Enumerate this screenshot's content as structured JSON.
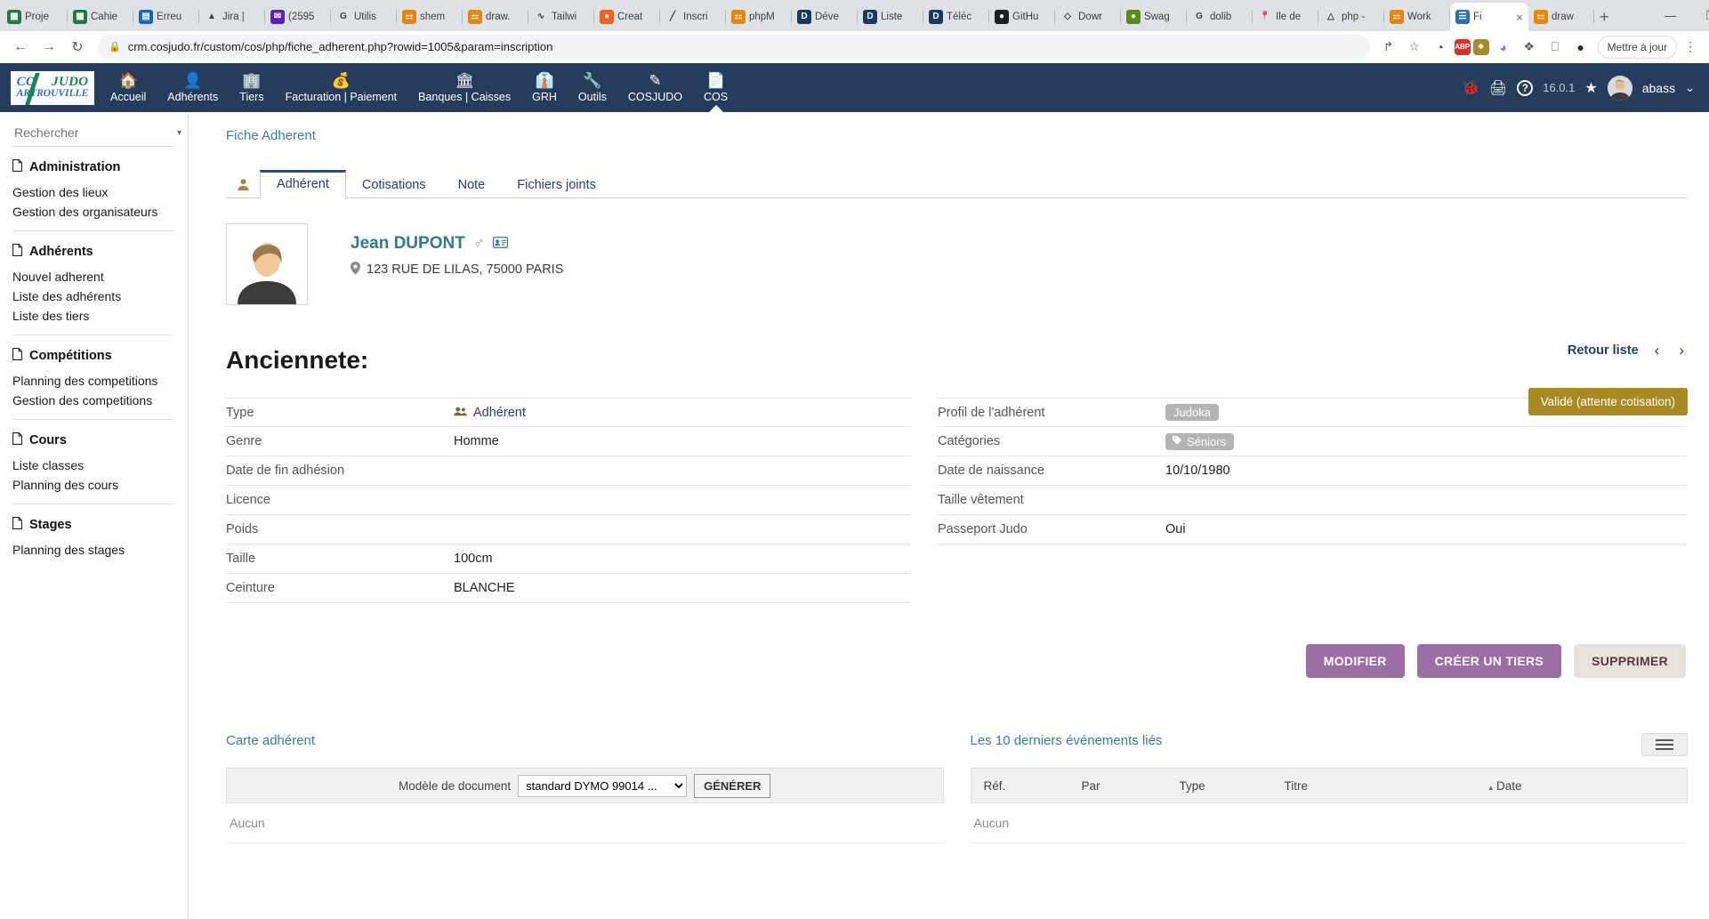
{
  "browser": {
    "tabs": [
      {
        "title": "Proje",
        "favicon": "spreadsheet-green",
        "color": "#1e7a43",
        "glyph": "▦"
      },
      {
        "title": "Cahie",
        "favicon": "spreadsheet-green",
        "color": "#1e7a43",
        "glyph": "▦"
      },
      {
        "title": "Erreu",
        "favicon": "trello-blue",
        "color": "#1565c0",
        "glyph": "▤"
      },
      {
        "title": "Jira |",
        "favicon": "jira-blue",
        "color": "#ffffff",
        "glyph": "▲"
      },
      {
        "title": "(2595",
        "favicon": "mail-purple",
        "color": "#5b21b6",
        "glyph": "✉"
      },
      {
        "title": "Utilis",
        "favicon": "google-g",
        "color": "#ffffff",
        "glyph": "G"
      },
      {
        "title": "shem",
        "favicon": "drawio-orange",
        "color": "#e8830c",
        "glyph": "⚏"
      },
      {
        "title": "draw.",
        "favicon": "drawio-orange",
        "color": "#e8830c",
        "glyph": "⚏"
      },
      {
        "title": "Tailwi",
        "favicon": "tailwind-cyan",
        "color": "#ffffff",
        "glyph": "∿"
      },
      {
        "title": "Creat",
        "favicon": "flame-orange",
        "color": "#f26122",
        "glyph": "●"
      },
      {
        "title": "Inscri",
        "favicon": "pencil-blue",
        "color": "#ffffff",
        "glyph": "╱"
      },
      {
        "title": "phpM",
        "favicon": "phpmyadmin-orange",
        "color": "#e8830c",
        "glyph": "⚏"
      },
      {
        "title": "Déve",
        "favicon": "dolibarr-d",
        "color": "#1b3a63",
        "glyph": "D"
      },
      {
        "title": "Liste",
        "favicon": "dolibarr-d",
        "color": "#1b3a63",
        "glyph": "D"
      },
      {
        "title": "Téléc",
        "favicon": "dolibarr-d",
        "color": "#1b3a63",
        "glyph": "D"
      },
      {
        "title": "GitHu",
        "favicon": "github-dark",
        "color": "#1b1f23",
        "glyph": "●"
      },
      {
        "title": "Dowr",
        "favicon": "diamond-orange",
        "color": "#ffffff",
        "glyph": "◇"
      },
      {
        "title": "Swag",
        "favicon": "swagger-green",
        "color": "#5a8a1a",
        "glyph": "●"
      },
      {
        "title": "dolib",
        "favicon": "google-g",
        "color": "#ffffff",
        "glyph": "G"
      },
      {
        "title": "Ile de",
        "favicon": "maps-pin",
        "color": "#ffffff",
        "glyph": "📍"
      },
      {
        "title": "php -",
        "favicon": "drive-triangle",
        "color": "#ffffff",
        "glyph": "△"
      },
      {
        "title": "Work",
        "favicon": "drawio-orange",
        "color": "#e8830c",
        "glyph": "⚏"
      },
      {
        "title": "Fi",
        "favicon": "judo-site",
        "color": "#2e6fb7",
        "glyph": "☰",
        "active": true
      },
      {
        "title": "draw",
        "favicon": "drawio-orange",
        "color": "#e8830c",
        "glyph": "⚏"
      }
    ],
    "new_tab_label": "+",
    "tab_close_label": "×",
    "window_controls": [
      "ⱟ",
      "—",
      "❐",
      "✕"
    ],
    "nav": {
      "back": "←",
      "forward": "→",
      "reload": "↻"
    },
    "omnibox": {
      "lock": "🔒",
      "url": "crm.cosjudo.fr/custom/cos/php/fiche_adherent.php?rowid=1005&param=inscription"
    },
    "toolbar_icons": [
      {
        "name": "share-icon",
        "glyph": "↱",
        "color": "#5f6368"
      },
      {
        "name": "bookmark-star-icon",
        "glyph": "☆",
        "color": "#5f6368"
      },
      {
        "name": "ghostery-icon",
        "glyph": "◔",
        "color": "#3c4043"
      },
      {
        "name": "adblock-plus-icon",
        "glyph": "ABP",
        "color": "#ffffff",
        "bg": "#d5322a"
      },
      {
        "name": "lastpass-icon",
        "glyph": "❖",
        "color": "#ffffff",
        "bg": "#a68b2d"
      },
      {
        "name": "colorpick-icon",
        "glyph": "◕",
        "color": "#a06cd5"
      },
      {
        "name": "extensions-puzzle-icon",
        "glyph": "❖",
        "color": "#5f6368"
      },
      {
        "name": "sidepanel-icon",
        "glyph": "⎕",
        "color": "#5f6368"
      },
      {
        "name": "profile-avatar-icon",
        "glyph": "●",
        "color": "#2b2b2b"
      }
    ],
    "update_button": {
      "label": "Mettre à jour",
      "menu": "⋮"
    }
  },
  "app_nav": {
    "logo": {
      "line1a": "CO",
      "line1b": "JUDO",
      "line2": "ARTROUVILLE"
    },
    "items": [
      {
        "label": "Accueil",
        "icon": "home-icon",
        "glyph": "🏠"
      },
      {
        "label": "Adhérents",
        "icon": "user-icon",
        "glyph": "👤"
      },
      {
        "label": "Tiers",
        "icon": "building-icon",
        "glyph": "🏢"
      },
      {
        "label": "Facturation | Paiement",
        "icon": "coins-icon",
        "glyph": "💰"
      },
      {
        "label": "Banques | Caisses",
        "icon": "bank-icon",
        "glyph": "🏛"
      },
      {
        "label": "GRH",
        "icon": "employee-icon",
        "glyph": "👔"
      },
      {
        "label": "Outils",
        "icon": "wrench-icon",
        "glyph": "🔧"
      },
      {
        "label": "COSJUDO",
        "icon": "pencil-square-icon",
        "glyph": "✎"
      },
      {
        "label": "COS",
        "icon": "document-icon",
        "glyph": "📄",
        "active": true
      }
    ],
    "right": {
      "bug_icon": "🐞",
      "print_icon": "🖨",
      "help_icon": "?",
      "version": "16.0.1",
      "star_icon": "★",
      "user": "abass",
      "caret": "⌄"
    }
  },
  "sidebar": {
    "search_placeholder": "Rechercher",
    "caret": "▾",
    "groups": [
      {
        "title": "Administration",
        "links": [
          "Gestion des lieux",
          "Gestion des organisateurs"
        ]
      },
      {
        "title": "Adhérents",
        "links": [
          "Nouvel adherent",
          "Liste des adhérents",
          "Liste des tiers"
        ]
      },
      {
        "title": "Compétitions",
        "links": [
          "Planning des competitions",
          "Gestion des competitions"
        ]
      },
      {
        "title": "Cours",
        "links": [
          "Liste classes",
          "Planning des cours"
        ]
      },
      {
        "title": "Stages",
        "links": [
          "Planning des stages"
        ]
      }
    ]
  },
  "main": {
    "breadcrumb": "Fiche Adherent",
    "tabs": [
      {
        "label": "Adhérent",
        "selected": true
      },
      {
        "label": "Cotisations",
        "selected": false
      },
      {
        "label": "Note",
        "selected": false
      },
      {
        "label": "Fichiers joints",
        "selected": false
      }
    ],
    "identity": {
      "name": "Jean DUPONT",
      "gender_symbol": "♂",
      "address": "123 RUE DE LILAS, 75000 PARIS"
    },
    "retour": {
      "label": "Retour liste",
      "prev": "‹",
      "next": "›"
    },
    "status_badge": "Validé (attente cotisation)",
    "section_title": "Anciennete:",
    "details_left": [
      {
        "label": "Type",
        "value": "Adhérent",
        "kind": "link-with-icon"
      },
      {
        "label": "Genre",
        "value": "Homme",
        "kind": "text"
      },
      {
        "label": "Date de fin adhésion",
        "value": "",
        "kind": "text"
      },
      {
        "label": "Licence",
        "value": "",
        "kind": "text"
      },
      {
        "label": "Poids",
        "value": "",
        "kind": "text"
      },
      {
        "label": "Taille",
        "value": "100cm",
        "kind": "text"
      },
      {
        "label": "Ceinture",
        "value": "BLANCHE",
        "kind": "text"
      }
    ],
    "details_right": [
      {
        "label": "Profil de l'adhérent",
        "value": "Judoka",
        "kind": "chip"
      },
      {
        "label": "Catégories",
        "value": "Séniors",
        "kind": "chip-tag"
      },
      {
        "label": "Date de naissance",
        "value": "10/10/1980",
        "kind": "text"
      },
      {
        "label": "Taille vêtement",
        "value": "",
        "kind": "text"
      },
      {
        "label": "Passeport Judo",
        "value": "Oui",
        "kind": "text"
      }
    ],
    "buttons": [
      {
        "label": "MODIFIER",
        "style": "purple"
      },
      {
        "label": "CRÉER UN TIERS",
        "style": "purple"
      },
      {
        "label": "SUPPRIMER",
        "style": "grey"
      }
    ],
    "carte_adherent": {
      "title": "Carte adhérent",
      "model_label": "Modèle de document",
      "model_selected": "standard DYMO 99014 ...",
      "generate_label": "GÉNÉRER",
      "empty_text": "Aucun"
    },
    "events": {
      "title": "Les 10 derniers événements liés",
      "columns": [
        "Réf.",
        "Par",
        "Type",
        "Titre",
        "Date"
      ],
      "sort_caret": "▴",
      "empty_text": "Aucun"
    }
  },
  "colors": {
    "navbar": "#263c5c",
    "accent_teal": "#3c7d93",
    "badge_gold": "#a98921",
    "btn_purple": "#9b6fa3"
  }
}
